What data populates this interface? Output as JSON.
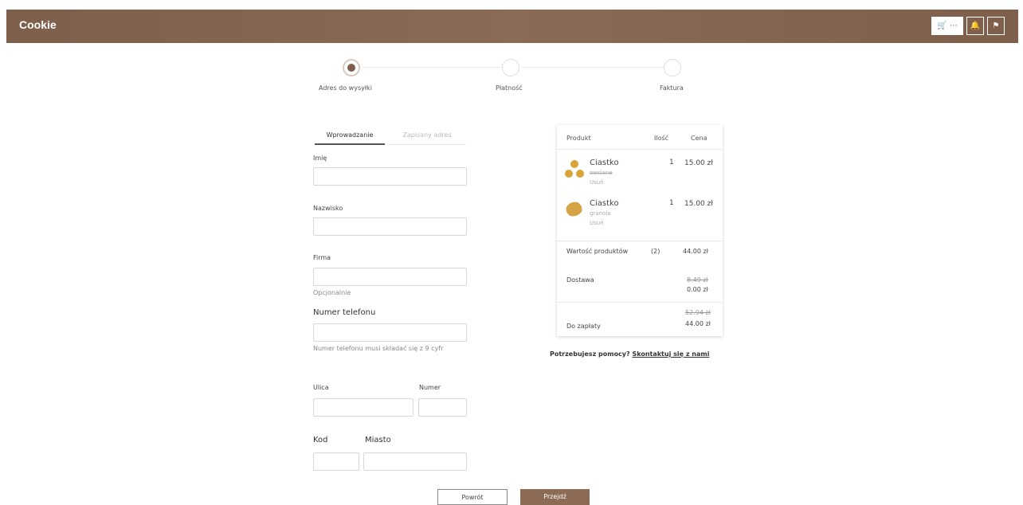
{
  "header": {
    "brand": "Cookie",
    "cart_label": "🛒 ⋯",
    "bell_glyph": "🔔",
    "user_glyph": "⚑"
  },
  "stepper": {
    "steps": [
      "Adres do wysyłki",
      "Płatność",
      "Faktura"
    ],
    "active_index": 0
  },
  "tabs": [
    "Wprowadzanie",
    "Zapisany adres"
  ],
  "form": {
    "name_label": "Imię",
    "surname_label": "Nazwisko",
    "company_label": "Firma",
    "company_hint": "Opcjonalnie",
    "phone_label": "Numer telefonu",
    "phone_hint": "Numer telefonu musi składać się z 9 cyfr",
    "street_label": "Ulica",
    "number_label": "Numer",
    "zip_label": "Kod",
    "city_label": "Miasto"
  },
  "summary": {
    "headers": {
      "product": "Produkt",
      "qty": "Ilość",
      "price": "Cena"
    },
    "items": [
      {
        "name": "Ciastko",
        "sub": "owsiane",
        "sub2": "Usuń",
        "qty": "1",
        "price": "15.00 zł"
      },
      {
        "name": "Ciastko",
        "sub": "granola",
        "sub2": "Usuń",
        "qty": "1",
        "price": "15.00 zł"
      }
    ],
    "products_value_label": "Wartość produktów",
    "products_count": "(2)",
    "products_value": "44.00 zł",
    "delivery_label": "Dostawa",
    "delivery_old": "8.49 zł",
    "delivery_new": "0.00 zł",
    "total_old": "52.94 zł",
    "total_label": "Do zapłaty",
    "total_value": "44.00 zł"
  },
  "help": {
    "question": "Potrzebujesz pomocy?",
    "link": "Skontaktuj się z nami"
  },
  "buttons": {
    "back": "Powrót",
    "next": "Przejdź"
  },
  "colors": {
    "brand": "#7d5f4c",
    "button_primary": "#8b6b56"
  }
}
